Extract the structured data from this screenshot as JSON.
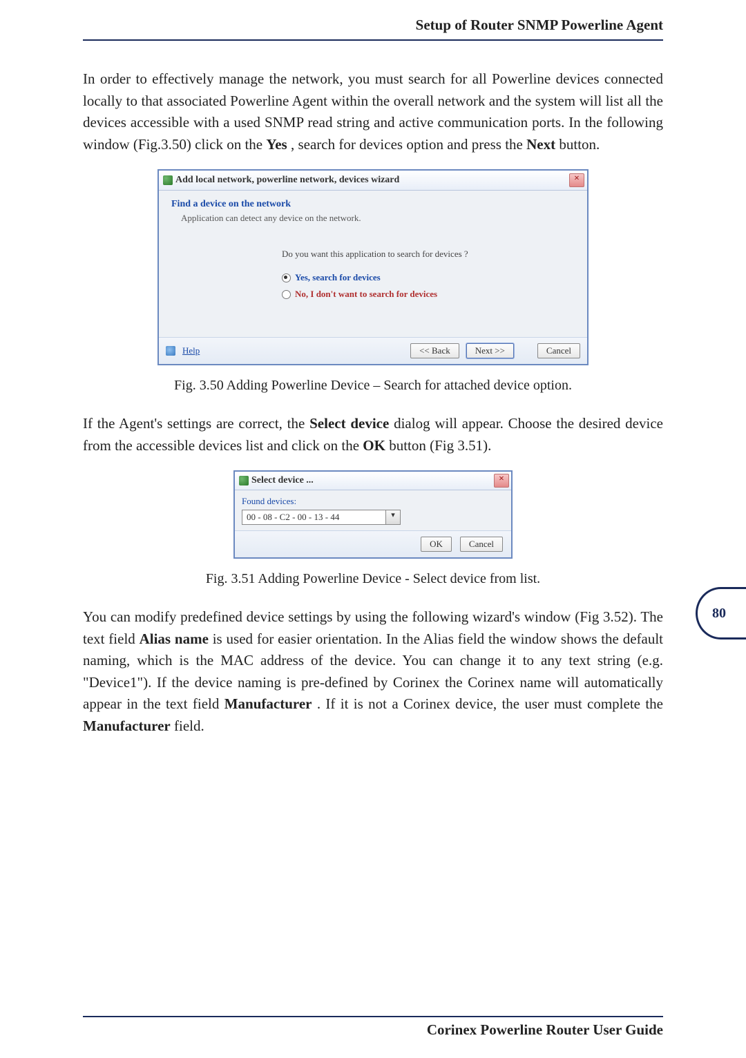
{
  "header": {
    "title": "Setup of Router SNMP Powerline Agent"
  },
  "page_number": "80",
  "footer": {
    "text": "Corinex Powerline Router User Guide"
  },
  "para1": {
    "t1": "In order to effectively manage the network, you must search for all Powerline devices connected locally to that associated Powerline Agent within the overall network and the system will list all the devices accessible with a used SNMP read string and active communication ports. In the following window (Fig.3.50) click on the ",
    "b1": "Yes",
    "t2": ", search for devices option and press the ",
    "b2": "Next",
    "t3": " button."
  },
  "dlg1": {
    "title": "Add local network, powerline network, devices wizard",
    "heading": "Find a device on the network",
    "sub": "Application can detect any device on the network.",
    "question": "Do you want this application to search for devices ?",
    "opt_yes": "Yes, search for devices",
    "opt_no": "No,  I don't want to search for devices",
    "help": "Help",
    "back": "<< Back",
    "next": "Next >>",
    "cancel": "Cancel"
  },
  "caption1": "Fig. 3.50 Adding Powerline Device – Search for attached device option.",
  "para2": {
    "t1": "If the Agent's settings are correct, the ",
    "b1": "Select device",
    "t2": " dialog will appear. Choose the desired device from the accessible devices list and click on the ",
    "b2": "OK",
    "t3": " button (Fig 3.51)."
  },
  "dlg2": {
    "title": "Select device ...",
    "label": "Found devices:",
    "value": "00 - 08 - C2 - 00 - 13 - 44",
    "ok": "OK",
    "cancel": "Cancel"
  },
  "caption2": "Fig. 3.51 Adding Powerline Device - Select device from list.",
  "para3": {
    "t1": "You can modify predefined device settings by using the following wizard's window (Fig 3.52). The text field ",
    "b1": "Alias name",
    "t2": " is used for easier orientation. In the Alias field the window shows the default naming, which is the MAC address of the device. You can change it to any text string (e.g. \"Device1\"). If the device naming is pre-defined by Corinex the Corinex name will automatically appear in the text field ",
    "b2": "Manufacturer",
    "t3": ". If it is not a Corinex device, the user must complete the ",
    "b3": "Manufacturer",
    "t4": " field."
  }
}
